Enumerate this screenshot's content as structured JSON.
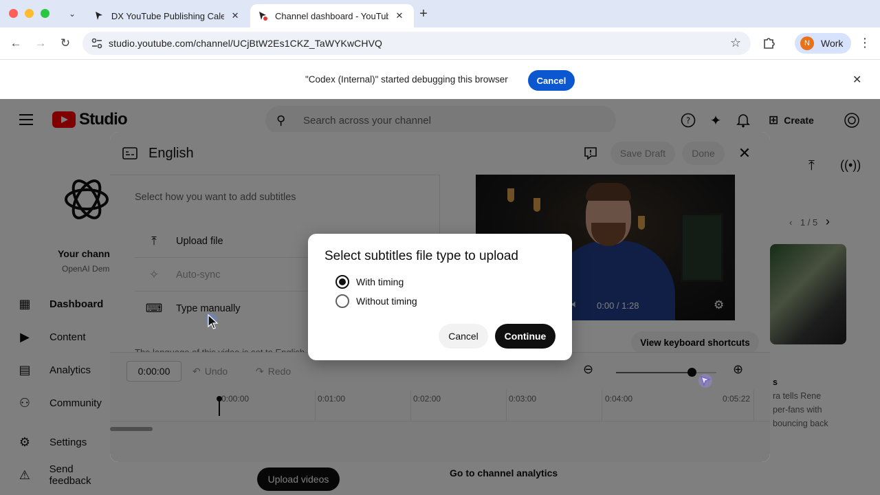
{
  "browser": {
    "tabs": [
      {
        "title": "DX YouTube Publishing Calen",
        "active": false
      },
      {
        "title": "Channel dashboard - YouTube",
        "active": true
      }
    ],
    "url": "studio.youtube.com/channel/UCjBtW2Es1CKZ_TaWYKwCHVQ",
    "profile_initial": "N",
    "profile_label": "Work",
    "infobar_message": "\"Codex (Internal)\" started debugging this browser",
    "infobar_cancel": "Cancel"
  },
  "studio": {
    "logo_text": "Studio",
    "search_placeholder": "Search across your channel",
    "create_label": "Create",
    "channel_name": "Your chann",
    "channel_sub": "OpenAI Dem",
    "nav": [
      {
        "label": "Dashboard",
        "icon": "dashboard-icon",
        "active": true
      },
      {
        "label": "Content",
        "icon": "content-icon",
        "active": false
      },
      {
        "label": "Analytics",
        "icon": "analytics-icon",
        "active": false
      },
      {
        "label": "Community",
        "icon": "community-icon",
        "active": false
      },
      {
        "label": "Settings",
        "icon": "gear-icon",
        "active": false
      },
      {
        "label": "Send feedback",
        "icon": "feedback-icon",
        "active": false
      }
    ],
    "upload_videos": "Upload videos",
    "channel_analytics_link": "Go to channel analytics",
    "carousel_page": "1 / 5",
    "card_text_lines": [
      "s",
      "ra tells Rene",
      "per-fans with",
      "bouncing back"
    ]
  },
  "editor": {
    "title": "English",
    "save_draft": "Save Draft",
    "done": "Done",
    "prompt": "Select how you want to add subtitles",
    "methods": [
      {
        "label": "Upload file",
        "icon": "upload-icon",
        "disabled": false
      },
      {
        "label": "Auto-sync",
        "icon": "sparkle-icon",
        "disabled": true
      },
      {
        "label": "Type manually",
        "icon": "keyboard-icon",
        "disabled": false
      }
    ],
    "language_note": "The language of this video is set to English",
    "video_time": "0:00 / 1:28",
    "shortcuts": "View keyboard shortcuts",
    "timecode": "0:00:00",
    "undo": "Undo",
    "redo": "Redo",
    "zoom_level": 0.75,
    "ticks": [
      "0:00:00",
      "0:01:00",
      "0:02:00",
      "0:03:00",
      "0:04:00",
      "0:05:22"
    ]
  },
  "modal": {
    "title": "Select subtitles file type to upload",
    "options": [
      {
        "label": "With timing",
        "checked": true
      },
      {
        "label": "Without timing",
        "checked": false
      }
    ],
    "cancel": "Cancel",
    "continue": "Continue"
  }
}
